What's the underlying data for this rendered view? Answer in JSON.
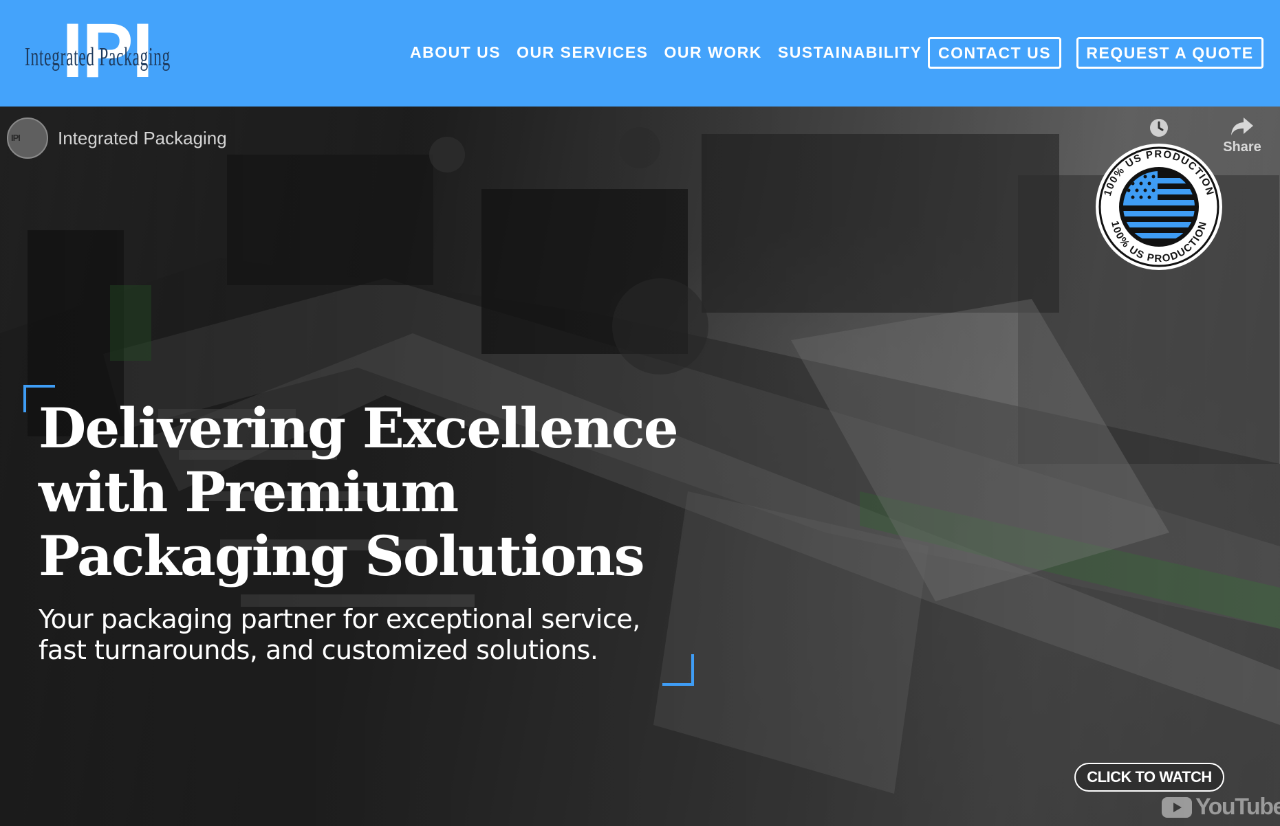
{
  "header": {
    "logo_mark": "IPI",
    "logo_text": "Integrated Packaging",
    "nav": [
      "ABOUT US",
      "OUR SERVICES",
      "OUR WORK",
      "SUSTAINABILITY"
    ],
    "contact_label": "CONTACT US",
    "quote_label": "REQUEST A QUOTE"
  },
  "video": {
    "channel_name": "Integrated Packaging",
    "channel_avatar_text": "IPI",
    "share_label": "Share",
    "badge_top": "100% US PRODUCTION",
    "badge_bottom": "100% US PRODUCTION",
    "watch_label": "CLICK TO WATCH",
    "platform_label": "YouTube"
  },
  "hero": {
    "headline_lines": [
      "Delivering Excellence",
      "with Premium",
      "Packaging Solutions"
    ],
    "subtitle_lines": [
      "Your packaging partner for exceptional service,",
      "fast turnarounds, and customized solutions."
    ]
  },
  "colors": {
    "header_bg": "#44a3fb",
    "accent": "#3f9df5",
    "logo_text": "#1e3a5c"
  },
  "icons": [
    "clock-icon",
    "share-icon",
    "youtube-icon",
    "us-flag-icon"
  ]
}
